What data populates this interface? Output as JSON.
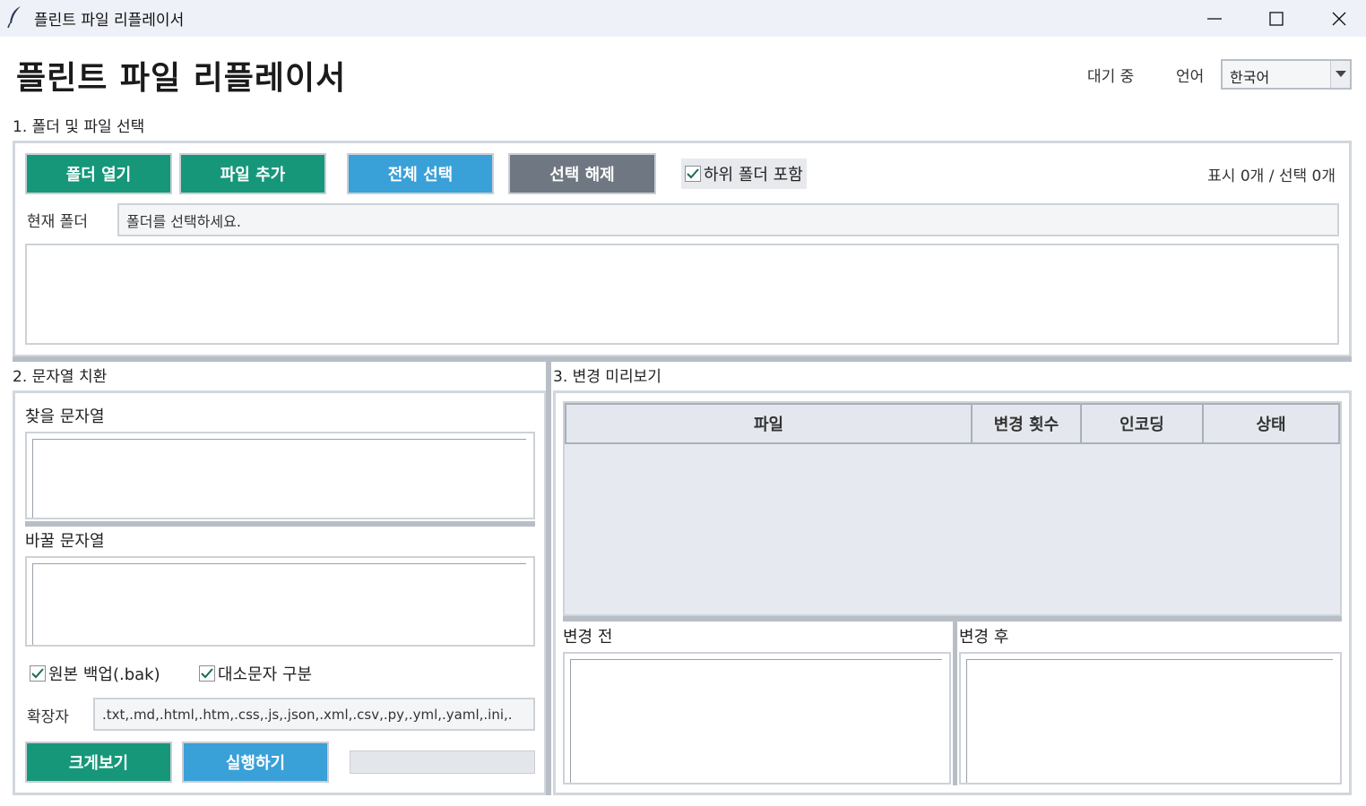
{
  "window": {
    "title": "플린트 파일 리플레이서"
  },
  "header": {
    "app_title": "플린트 파일 리플레이서",
    "status": "대기 중",
    "language_label": "언어",
    "language_value": "한국어"
  },
  "section1": {
    "label": "1. 폴더 및 파일 선택",
    "open_folder": "폴더 열기",
    "add_files": "파일 추가",
    "select_all": "전체 선택",
    "deselect": "선택 해제",
    "include_subfolders": "하위 폴더 포함",
    "include_subfolders_checked": true,
    "counter": "표시 0개 / 선택 0개",
    "current_folder_label": "현재 폴더",
    "current_folder_value": "폴더를 선택하세요."
  },
  "section2": {
    "label": "2. 문자열 치환",
    "find_label": "찾을 문자열",
    "replace_label": "바꿀 문자열",
    "backup": "원본 백업(.bak)",
    "backup_checked": true,
    "case_sensitive": "대소문자 구분",
    "case_checked": true,
    "extensions_label": "확장자",
    "extensions_value": ".txt,.md,.html,.htm,.css,.js,.json,.xml,.csv,.py,.yml,.yaml,.ini,.",
    "enlarge": "크게보기",
    "run": "실행하기"
  },
  "section3": {
    "label": "3. 변경 미리보기",
    "columns": [
      "파일",
      "변경 횟수",
      "인코딩",
      "상태"
    ],
    "before_label": "변경 전",
    "after_label": "변경 후"
  },
  "colors": {
    "green": "#16977a",
    "blue": "#3aa0d8",
    "gray": "#6f7782"
  }
}
